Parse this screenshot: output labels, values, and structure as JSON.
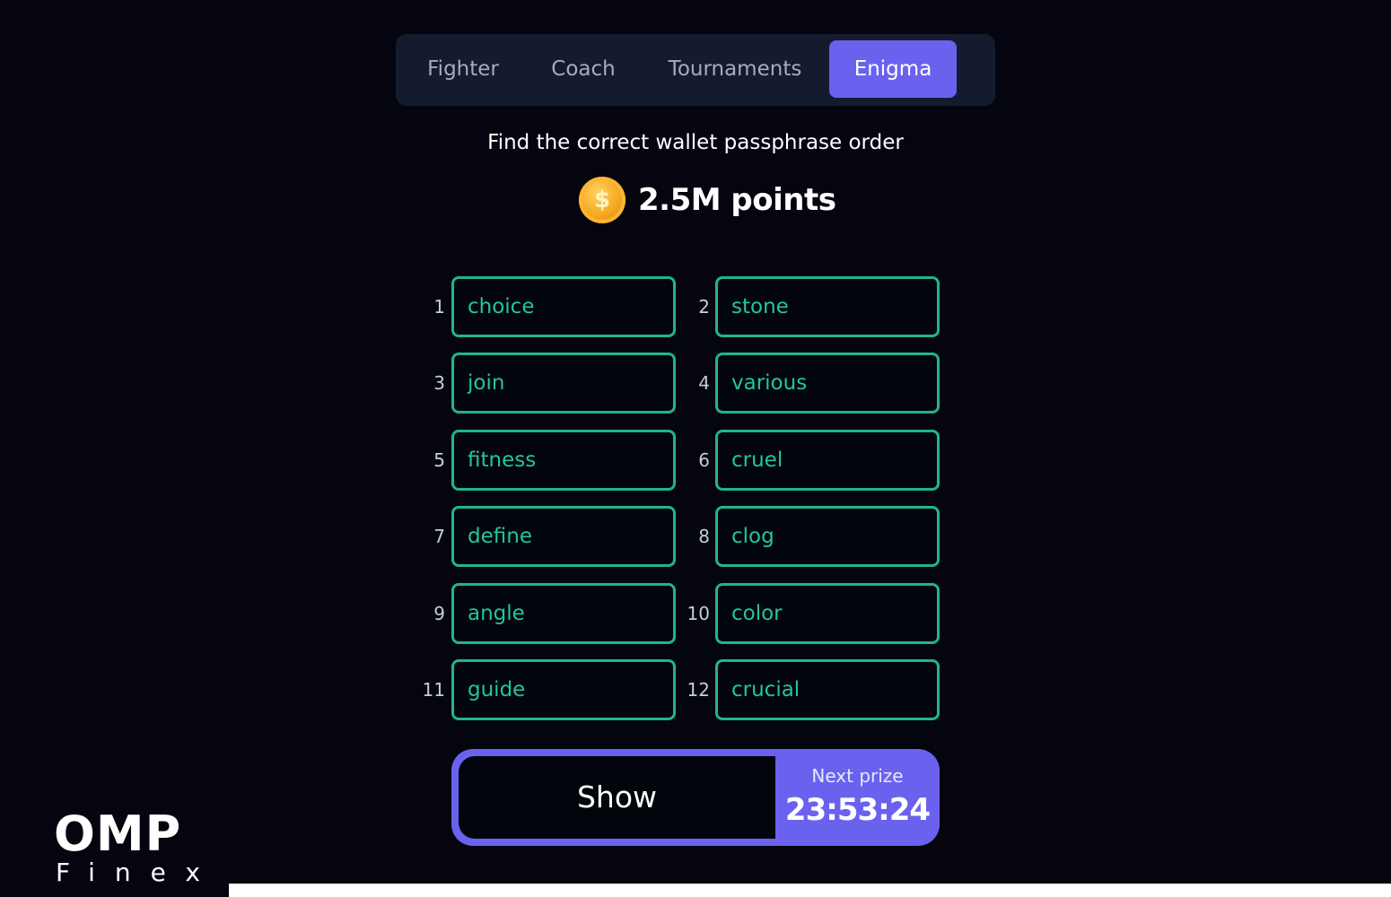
{
  "tabs": [
    {
      "label": "Fighter",
      "active": false
    },
    {
      "label": "Coach",
      "active": false
    },
    {
      "label": "Tournaments",
      "active": false
    },
    {
      "label": "Enigma",
      "active": true
    }
  ],
  "enigma": {
    "instruction": "Find the correct wallet passphrase order",
    "reward": "2.5M points",
    "coin_symbol": "$"
  },
  "words": [
    {
      "num": "1",
      "word": "choice"
    },
    {
      "num": "2",
      "word": "stone"
    },
    {
      "num": "3",
      "word": "join"
    },
    {
      "num": "4",
      "word": "various"
    },
    {
      "num": "5",
      "word": "fitness"
    },
    {
      "num": "6",
      "word": "cruel"
    },
    {
      "num": "7",
      "word": "define"
    },
    {
      "num": "8",
      "word": "clog"
    },
    {
      "num": "9",
      "word": "angle"
    },
    {
      "num": "10",
      "word": "color"
    },
    {
      "num": "11",
      "word": "guide"
    },
    {
      "num": "12",
      "word": "crucial"
    }
  ],
  "action": {
    "show_label": "Show",
    "next_prize_label": "Next prize",
    "timer": "23:53:24"
  },
  "watermark": {
    "brand": "OMP",
    "sub": "Finex"
  },
  "colors": {
    "background": "#04050f",
    "tabbar": "#141b2e",
    "accent": "#6a62ee",
    "word_border": "#20b58c",
    "word_text": "#22c797",
    "coin": "#f5a623"
  }
}
